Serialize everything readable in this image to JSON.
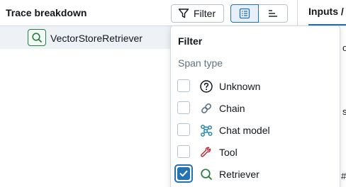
{
  "left": {
    "title": "Trace breakdown",
    "filter_button": "Filter",
    "span": {
      "label": "VectorStoreRetriever",
      "icon": "search-icon"
    }
  },
  "right": {
    "tab_label": "Inputs /",
    "fragments": [
      "o",
      "s",
      "#"
    ]
  },
  "filter_popover": {
    "title": "Filter",
    "section_label": "Span type",
    "options": [
      {
        "label": "Unknown",
        "icon": "question-circle-icon",
        "checked": false
      },
      {
        "label": "Chain",
        "icon": "link-icon",
        "checked": false
      },
      {
        "label": "Chat model",
        "icon": "connected-nodes-icon",
        "checked": false
      },
      {
        "label": "Tool",
        "icon": "wrench-icon",
        "checked": false
      },
      {
        "label": "Retriever",
        "icon": "search-icon",
        "checked": true
      }
    ]
  },
  "colors": {
    "accent": "#2272b4",
    "retriever_green": "#277c43",
    "chat_teal": "#1a80a4",
    "tool_red": "#c8202f",
    "muted_text": "#5f7281",
    "border": "#d1d9e1"
  }
}
